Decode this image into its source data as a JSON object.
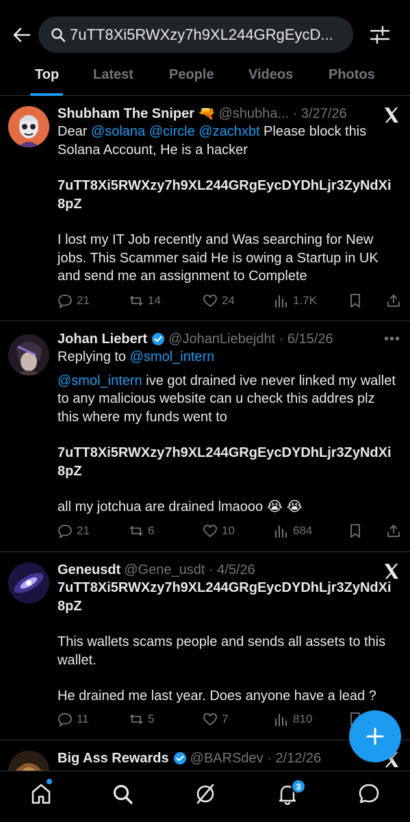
{
  "search": {
    "query": "7uTT8Xi5RWXzy7h9XL244GRgEycD..."
  },
  "tabs": [
    "Top",
    "Latest",
    "People",
    "Videos",
    "Photos"
  ],
  "tweets": [
    {
      "name": "Shubham The Sniper 🔫",
      "meta": "@shubha... · 3/27/26",
      "line1_prefix": "Dear ",
      "mentions": [
        "@solana",
        "@circle",
        "@zachxbt"
      ],
      "line1_suffix": " Please block this",
      "line2": "Solana Account, He is a hacker",
      "address1": "7uTT8Xi5RWXzy7h9XL244GRgEycDYDhLjr3ZyNdXi",
      "address2": "8pZ",
      "para": [
        "I lost my IT Job recently and Was searching for New",
        "jobs. This Scammer said He is owing a Startup in UK",
        "and send me an assignment to Complete"
      ],
      "replies": "21",
      "reposts": "14",
      "likes": "24",
      "views": "1.7K"
    },
    {
      "name": "Johan Liebert",
      "meta": "@JohanLiebejdht · 6/15/26",
      "replying_prefix": "Replying to ",
      "replying_to": "@smol_intern",
      "mention": "@smol_intern",
      "line1_suffix": " ive got drained ive never linked my wallet",
      "lines": [
        "to any malicious website can u check this addres plz",
        "this where my funds went to"
      ],
      "address1": "7uTT8Xi5RWXzy7h9XL244GRgEycDYDhLjr3ZyNdXi",
      "address2": "8pZ",
      "closing": "all my jotchua are drained lmaooo 😭 😭",
      "replies": "21",
      "reposts": "6",
      "likes": "10",
      "views": "684"
    },
    {
      "name": "Geneusdt",
      "meta": "@Gene_usdt · 4/5/26",
      "address1": "7uTT8Xi5RWXzy7h9XL244GRgEycDYDhLjr3ZyNdXi",
      "address2": "8pZ",
      "para": [
        "This wallets scams people and sends all assets to this",
        "wallet."
      ],
      "para2": "He drained me last year.  Does anyone have a lead ?",
      "replies": "11",
      "reposts": "5",
      "likes": "7",
      "views": "810"
    },
    {
      "name": "Big Ass Rewards",
      "meta": "@BARSdev · 2/12/26"
    }
  ],
  "notifications_badge": "3",
  "colors": {
    "accent": "#1d9bf0",
    "background": "#000000",
    "text": "#e7e9ea",
    "muted": "#71767b",
    "divider": "#2f3336"
  }
}
